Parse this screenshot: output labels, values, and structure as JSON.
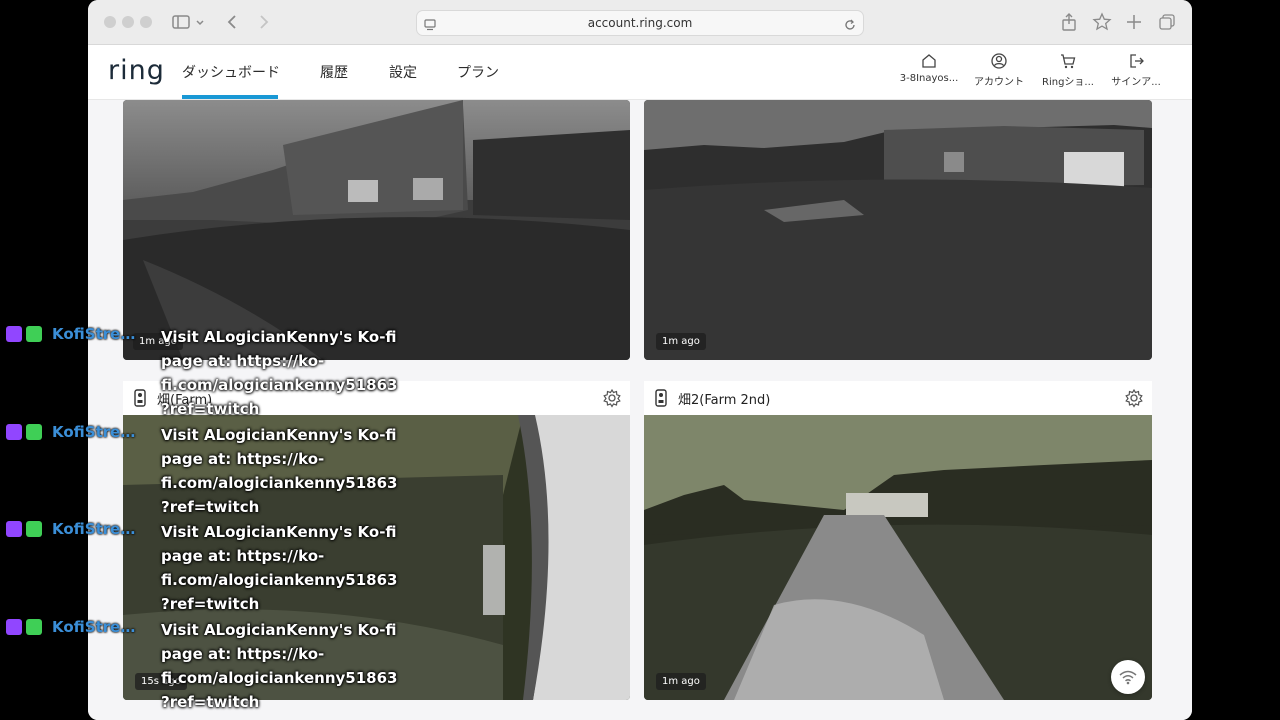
{
  "browser": {
    "url": "account.ring.com"
  },
  "app": {
    "logo": "ring",
    "nav": [
      "ダッシュボード",
      "履歴",
      "設定",
      "プラン"
    ],
    "active_nav_index": 0,
    "header_buttons": [
      {
        "label": "3-8Inayos...",
        "icon": "home-icon"
      },
      {
        "label": "アカウント",
        "icon": "account-icon"
      },
      {
        "label": "Ringショ...",
        "icon": "cart-icon"
      },
      {
        "label": "サインア...",
        "icon": "sign-out-icon"
      }
    ]
  },
  "cameras": [
    {
      "title": "",
      "time": "1m ago"
    },
    {
      "title": "",
      "time": "1m ago"
    },
    {
      "title": "畑(Farm)",
      "time": "15s ago"
    },
    {
      "title": "畑2(Farm 2nd)",
      "time": "1m ago"
    }
  ],
  "chat": [
    {
      "user": "KofiStrea...",
      "message": "Visit ALogicianKenny's Ko-fi page at: https://ko-fi.com/alogiciankenny51863 ?ref=twitch"
    },
    {
      "user": "KofiStrea...",
      "message": "Visit ALogicianKenny's Ko-fi page at: https://ko-fi.com/alogiciankenny51863 ?ref=twitch"
    },
    {
      "user": "KofiStrea...",
      "message": "Visit ALogicianKenny's Ko-fi page at: https://ko-fi.com/alogiciankenny51863 ?ref=twitch"
    },
    {
      "user": "KofiStrea...",
      "message": "Visit ALogicianKenny's Ko-fi page at: https://ko-fi.com/alogiciankenny51863 ?ref=twitch"
    }
  ],
  "colors": {
    "accent": "#1998d5",
    "twitch_badge": "#9146ff",
    "kofi_badge": "#3fcf56",
    "chat_username": "#3b8fd8"
  }
}
